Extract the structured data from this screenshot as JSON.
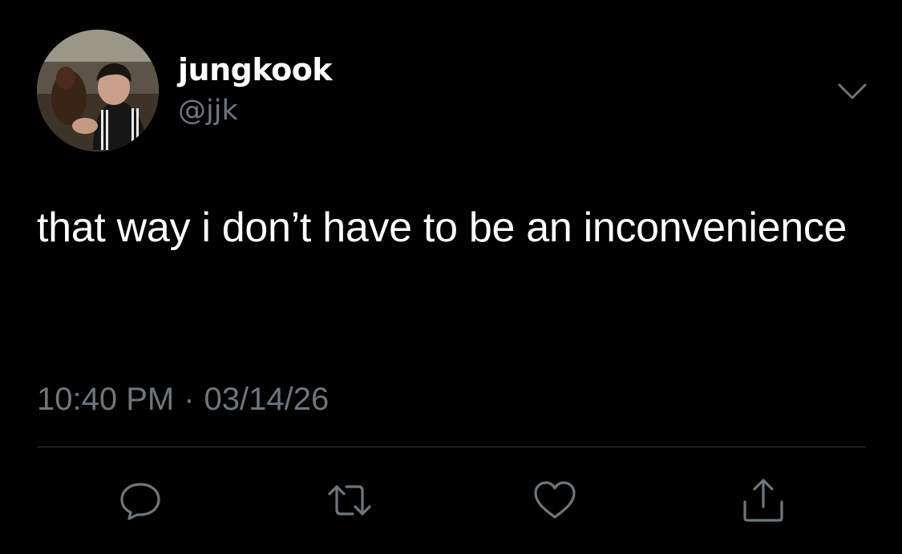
{
  "user": {
    "display_name": "jungkook",
    "handle": "@jjk",
    "avatar_icon": "profile-photo"
  },
  "tweet": {
    "text": "that way i don’t have to be an inconvenience",
    "time": "10:40 PM",
    "separator": "·",
    "date": "03/14/26"
  },
  "actions": [
    {
      "name": "reply",
      "icon": "speech-bubble-icon"
    },
    {
      "name": "retweet",
      "icon": "retweet-arrows-icon"
    },
    {
      "name": "like",
      "icon": "heart-icon"
    },
    {
      "name": "share",
      "icon": "share-upload-icon"
    }
  ],
  "colors": {
    "background": "#000000",
    "primary_text": "#ffffff",
    "secondary_text": "#6e767d",
    "divider": "#2f3336"
  }
}
